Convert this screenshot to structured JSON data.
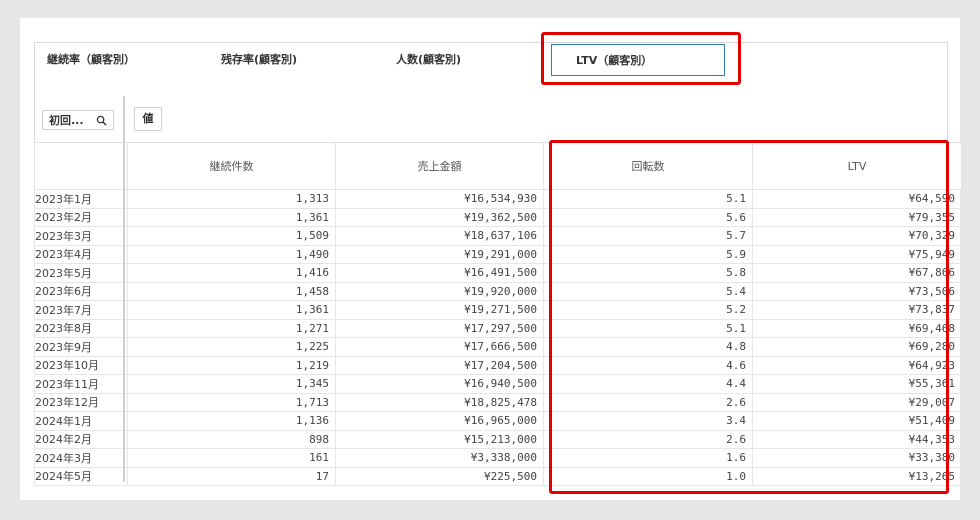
{
  "tabs": [
    "継続率（顧客別）",
    "残存率(顧客別)",
    "人数(顧客別)"
  ],
  "active_tab": "LTV（顧客別）",
  "filter": {
    "search_label": "初回...",
    "value_chip": "値"
  },
  "table": {
    "columns": [
      "継続件数",
      "売上金額",
      "回転数",
      "LTV"
    ],
    "rows": [
      [
        "2023年1月",
        "1,313",
        "¥16,534,930",
        "5.1",
        "¥64,590"
      ],
      [
        "2023年2月",
        "1,361",
        "¥19,362,500",
        "5.6",
        "¥79,355"
      ],
      [
        "2023年3月",
        "1,509",
        "¥18,637,106",
        "5.7",
        "¥70,329"
      ],
      [
        "2023年4月",
        "1,490",
        "¥19,291,000",
        "5.9",
        "¥75,949"
      ],
      [
        "2023年5月",
        "1,416",
        "¥16,491,500",
        "5.8",
        "¥67,866"
      ],
      [
        "2023年6月",
        "1,458",
        "¥19,920,000",
        "5.4",
        "¥73,506"
      ],
      [
        "2023年7月",
        "1,361",
        "¥19,271,500",
        "5.2",
        "¥73,837"
      ],
      [
        "2023年8月",
        "1,271",
        "¥17,297,500",
        "5.1",
        "¥69,468"
      ],
      [
        "2023年9月",
        "1,225",
        "¥17,666,500",
        "4.8",
        "¥69,280"
      ],
      [
        "2023年10月",
        "1,219",
        "¥17,204,500",
        "4.6",
        "¥64,923"
      ],
      [
        "2023年11月",
        "1,345",
        "¥16,940,500",
        "4.4",
        "¥55,361"
      ],
      [
        "2023年12月",
        "1,713",
        "¥18,825,478",
        "2.6",
        "¥29,007"
      ],
      [
        "2024年1月",
        "1,136",
        "¥16,965,000",
        "3.4",
        "¥51,409"
      ],
      [
        "2024年2月",
        "898",
        "¥15,213,000",
        "2.6",
        "¥44,353"
      ],
      [
        "2024年3月",
        "161",
        "¥3,338,000",
        "1.6",
        "¥33,380"
      ],
      [
        "2024年5月",
        "17",
        "¥225,500",
        "1.0",
        "¥13,265"
      ]
    ]
  }
}
